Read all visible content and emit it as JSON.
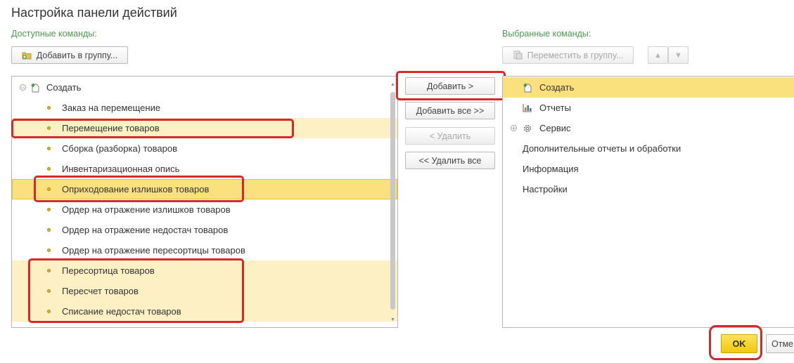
{
  "window": {
    "title": "Настройка панели действий"
  },
  "left": {
    "label": "Доступные команды:",
    "add_to_group": "Добавить в группу...",
    "tree_root": "Создать",
    "items": [
      "Заказ на перемещение",
      "Перемещение товаров",
      "Сборка (разборка) товаров",
      "Инвентаризационная опись",
      "Оприходование излишков товаров",
      "Ордер на отражение излишков товаров",
      "Ордер на отражение недостач товаров",
      "Ордер на отражение пересортицы товаров",
      "Пересортица товаров",
      "Пересчет товаров",
      "Списание недостач товаров"
    ]
  },
  "middle": {
    "add": "Добавить >",
    "add_all": "Добавить все >>",
    "remove": "< Удалить",
    "remove_all": "<< Удалить все"
  },
  "right": {
    "label": "Выбранные команды:",
    "move_to_group": "Переместить в группу...",
    "items": {
      "create": "Создать",
      "reports": "Отчеты",
      "service": "Сервис",
      "extra": "Дополнительные отчеты и обработки",
      "info": "Информация",
      "settings": "Настройки"
    }
  },
  "footer": {
    "ok": "OK",
    "cancel": "Отме"
  },
  "colors": {
    "highlight": "#fdf0c4",
    "selection": "#fbe07e",
    "accent_ok": "#f7d31b",
    "annotation": "#d62a2a",
    "label_green": "#4c9a4c"
  }
}
